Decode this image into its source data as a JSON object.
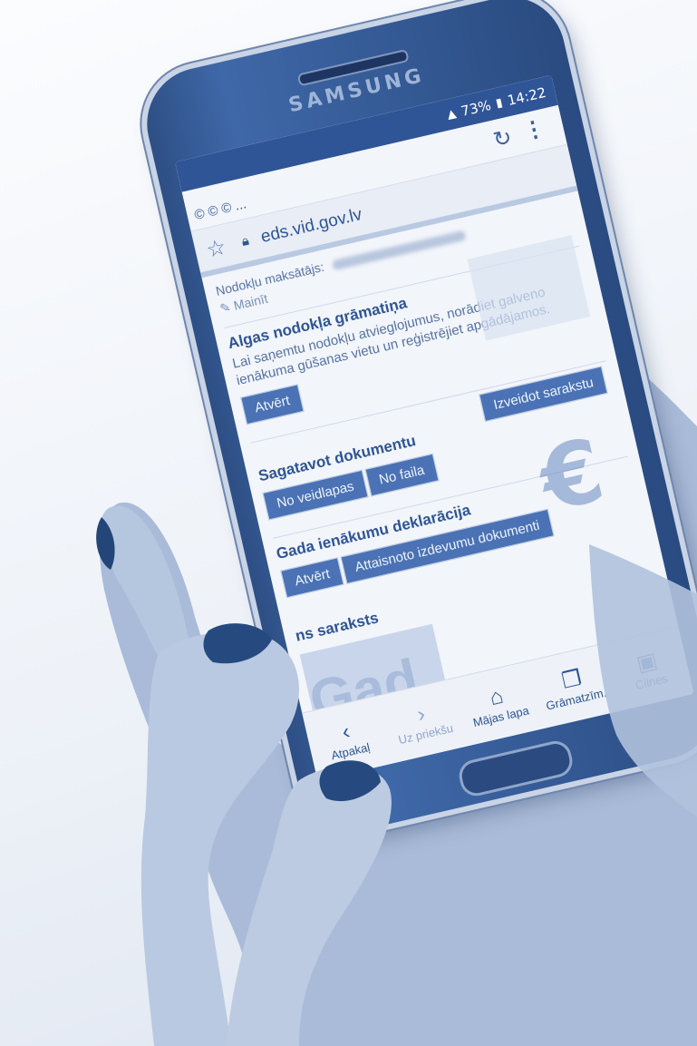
{
  "phone": {
    "brand": "SAMSUNG"
  },
  "status_bar": {
    "battery_percent": "73%",
    "time": "14:22"
  },
  "toolbar": {
    "notification_icons": "© © © ...",
    "reload_icon": "reload-icon",
    "menu_icon": "menu-icon"
  },
  "address_bar": {
    "url": "eds.vid.gov.lv"
  },
  "page": {
    "taxpayer_label": "Nodokļu maksātājs:",
    "change_link": "Mainīt",
    "cards": [
      {
        "title": "Algas nodokļa grāmatiņa",
        "text": "Lai saņemtu nodokļu atvieglojumus, norādiet galveno ienākuma gūšanas vietu un reģistrējiet apgādājamos.",
        "buttons": [
          "Atvērt"
        ]
      },
      {
        "title": "Sagatavot dokumentu",
        "side_button": "Izveidot sarakstu",
        "buttons": [
          "No veidlapas",
          "No faila"
        ]
      },
      {
        "title": "Gada ienākumu deklarācija",
        "buttons": [
          "Atvērt",
          "Attaisnoto izdevumu dokumenti"
        ]
      }
    ],
    "list_title": "ns saraksts",
    "image_text": "Gad"
  },
  "bottom_nav": [
    {
      "label": "Atpakaļ",
      "icon": "chevron-left-icon"
    },
    {
      "label": "Uz priekšu",
      "icon": "chevron-right-icon"
    },
    {
      "label": "Mājas lapa",
      "icon": "home-icon"
    },
    {
      "label": "Grāmatzīm.",
      "icon": "bookmark-icon"
    },
    {
      "label": "Cilnes",
      "icon": "tabs-icon"
    }
  ],
  "colors": {
    "duotone_dark": "#2f5597",
    "duotone_light": "#f2f5fa"
  }
}
